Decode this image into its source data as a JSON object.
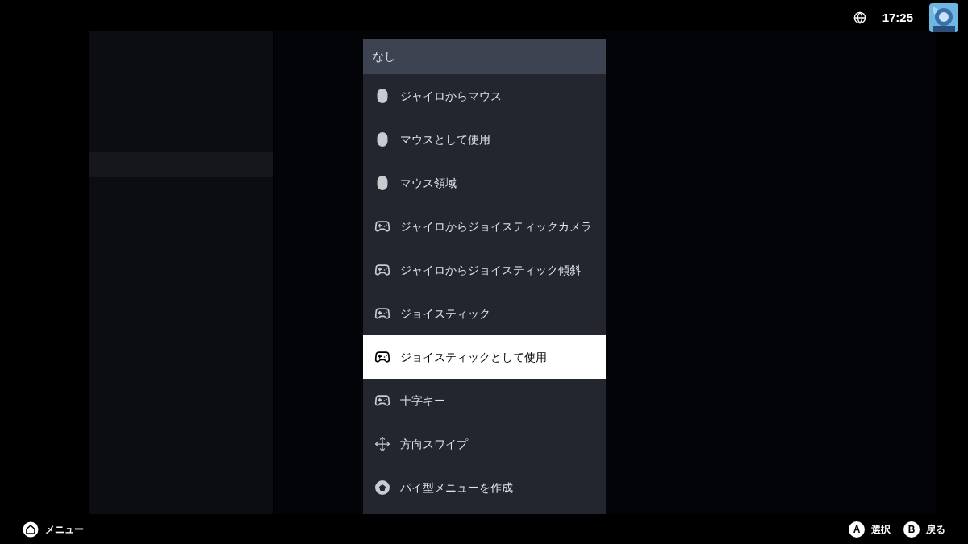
{
  "dropdown": {
    "header": "なし",
    "options": [
      {
        "label": "ジャイロからマウス",
        "kind": "mouse",
        "selected": false
      },
      {
        "label": "マウスとして使用",
        "kind": "mouse",
        "selected": false
      },
      {
        "label": "マウス領域",
        "kind": "mouse",
        "selected": false
      },
      {
        "label": "ジャイロからジョイスティックカメラ",
        "kind": "gamepad",
        "selected": false
      },
      {
        "label": "ジャイロからジョイスティック傾斜",
        "kind": "gamepad",
        "selected": false
      },
      {
        "label": "ジョイスティック",
        "kind": "gamepad",
        "selected": false
      },
      {
        "label": "ジョイスティックとして使用",
        "kind": "gamepad",
        "selected": true
      },
      {
        "label": "十字キー",
        "kind": "gamepad",
        "selected": false
      },
      {
        "label": "方向スワイプ",
        "kind": "swipe",
        "selected": false
      },
      {
        "label": "パイ型メニューを作成",
        "kind": "pie",
        "selected": false
      }
    ]
  },
  "status": {
    "time": "17:25"
  },
  "footer": {
    "menu": "メニュー",
    "actions": [
      {
        "button": "A",
        "label": "選択"
      },
      {
        "button": "B",
        "label": "戻る"
      }
    ]
  }
}
